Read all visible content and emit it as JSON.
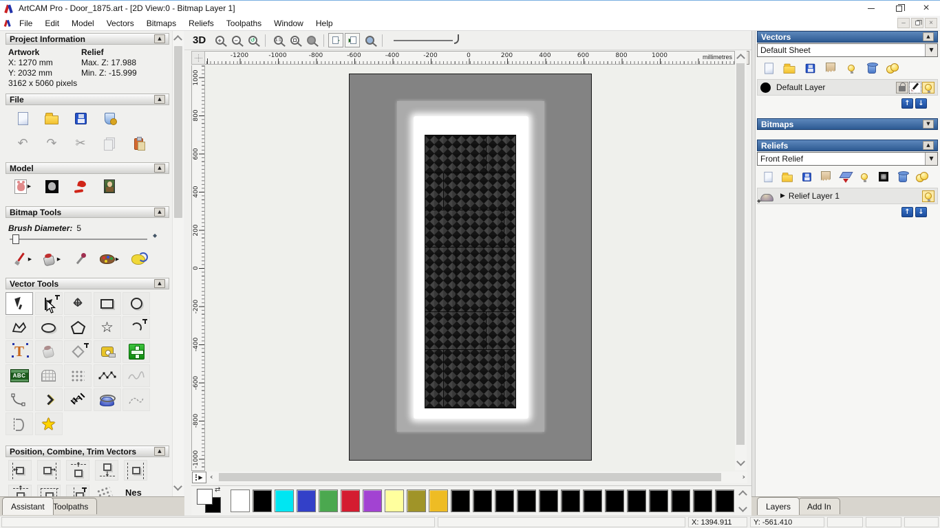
{
  "window": {
    "title": "ArtCAM Pro - Door_1875.art - [2D View:0 - Bitmap Layer 1]"
  },
  "menu": [
    "File",
    "Edit",
    "Model",
    "Vectors",
    "Bitmaps",
    "Reliefs",
    "Toolpaths",
    "Window",
    "Help"
  ],
  "assistant": {
    "project_information": {
      "title": "Project Information",
      "artwork_label": "Artwork",
      "artwork_x": "X: 1270 mm",
      "artwork_y": "Y: 2032 mm",
      "artwork_pixels": "3162 x 5060 pixels",
      "relief_label": "Relief",
      "relief_max": "Max. Z: 17.988",
      "relief_min": "Min. Z: -15.999"
    },
    "file_section_title": "File",
    "model_section_title": "Model",
    "bitmap_tools": {
      "title": "Bitmap Tools",
      "brush_label": "Brush Diameter:",
      "brush_value": "5"
    },
    "vector_tools_title": "Vector Tools",
    "position_section": {
      "title": "Position, Combine, Trim Vectors",
      "nesting_label": "Nes"
    },
    "tabs": [
      "Assistant",
      "Toolpaths"
    ]
  },
  "toolbar2d": {
    "label_3d": "3D"
  },
  "rulers": {
    "unit": "millimetres",
    "h_ticks": [
      -1200,
      -1000,
      -800,
      -600,
      -400,
      -200,
      0,
      200,
      400,
      600,
      800,
      1000
    ],
    "v_ticks": [
      1000,
      800,
      600,
      400,
      200,
      0,
      -200,
      -400,
      -600,
      -800,
      -1000
    ]
  },
  "right_panel": {
    "vectors": {
      "title": "Vectors",
      "sheet": "Default Sheet",
      "layer": "Default Layer"
    },
    "bitmaps": {
      "title": "Bitmaps"
    },
    "reliefs": {
      "title": "Reliefs",
      "relief": "Front Relief",
      "layer": "Relief Layer 1"
    },
    "tabs": [
      "Layers",
      "Add In"
    ]
  },
  "palette": {
    "swatches": [
      "#ffffff",
      "#000000",
      "#00e6f2",
      "#3340c8",
      "#4ba84f",
      "#d41c30",
      "#a243d2",
      "#ffff9e",
      "#a09428",
      "#eebc24",
      "#000000",
      "#000000",
      "#000000",
      "#000000",
      "#000000",
      "#000000",
      "#000000",
      "#000000",
      "#000000",
      "#000000",
      "#000000",
      "#000000",
      "#000000"
    ]
  },
  "status_bar": {
    "x": "X: 1394.911",
    "y": "Y: -561.410"
  },
  "icons": {
    "undo": "↶",
    "redo": "↷",
    "cut": "✂",
    "collapse": "▲",
    "expand_down": "▼",
    "dropdown": "▼",
    "flyout": "▶",
    "expand_arrow": "▶",
    "star_outline": "☆",
    "star_solid": "★",
    "up": "↑",
    "down": "↓",
    "move_h": "↔",
    "move_v": "↕",
    "scroll_left": "‹",
    "scroll_right": "›",
    "swap": "⇄",
    "abc": "ABC",
    "scissors": "✂",
    "align_left_arrow": "←",
    "align_right_arrow": "→",
    "align_up_arrow": "↑",
    "align_down_arrow": "↓",
    "diamond": "◆"
  }
}
